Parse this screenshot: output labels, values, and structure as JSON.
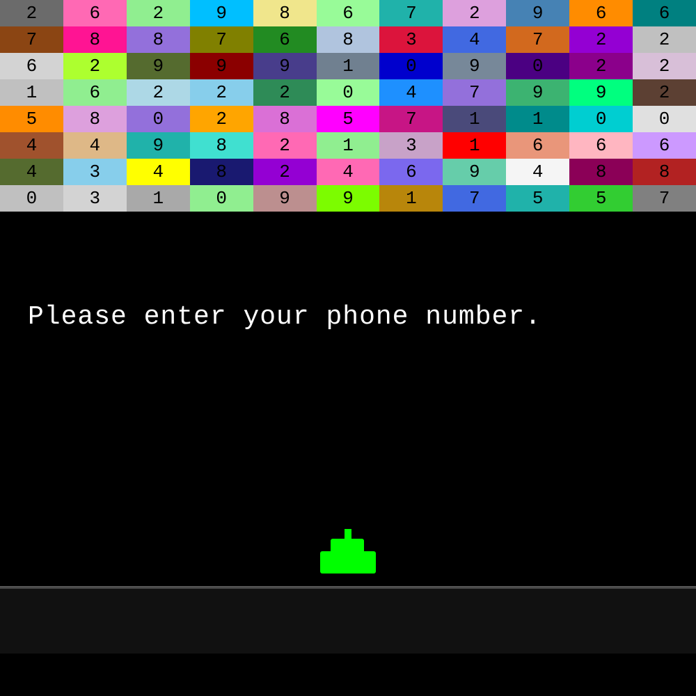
{
  "grid": {
    "rows": [
      [
        {
          "value": "2",
          "bg": "#6b6b6b"
        },
        {
          "value": "6",
          "bg": "#ff69b4"
        },
        {
          "value": "2",
          "bg": "#90ee90"
        },
        {
          "value": "9",
          "bg": "#00bfff"
        },
        {
          "value": "8",
          "bg": "#f0e68c"
        },
        {
          "value": "6",
          "bg": "#98fb98"
        },
        {
          "value": "7",
          "bg": "#20b2aa"
        },
        {
          "value": "2",
          "bg": "#dda0dd"
        },
        {
          "value": "9",
          "bg": "#4682b4"
        },
        {
          "value": "6",
          "bg": "#ff8c00"
        },
        {
          "value": "6",
          "bg": "#008080"
        }
      ],
      [
        {
          "value": "7",
          "bg": "#8b4513"
        },
        {
          "value": "8",
          "bg": "#ff1493"
        },
        {
          "value": "8",
          "bg": "#9370db"
        },
        {
          "value": "7",
          "bg": "#808000"
        },
        {
          "value": "6",
          "bg": "#228b22"
        },
        {
          "value": "8",
          "bg": "#b0c4de"
        },
        {
          "value": "3",
          "bg": "#dc143c"
        },
        {
          "value": "4",
          "bg": "#4169e1"
        },
        {
          "value": "7",
          "bg": "#d2691e"
        },
        {
          "value": "2",
          "bg": "#9400d3"
        },
        {
          "value": "2",
          "bg": "#c0c0c0"
        }
      ],
      [
        {
          "value": "6",
          "bg": "#d3d3d3"
        },
        {
          "value": "2",
          "bg": "#adff2f"
        },
        {
          "value": "9",
          "bg": "#556b2f"
        },
        {
          "value": "9",
          "bg": "#8b0000"
        },
        {
          "value": "9",
          "bg": "#483d8b"
        },
        {
          "value": "1",
          "bg": "#708090"
        },
        {
          "value": "0",
          "bg": "#0000cd"
        },
        {
          "value": "9",
          "bg": "#778899"
        },
        {
          "value": "0",
          "bg": "#4b0082"
        },
        {
          "value": "2",
          "bg": "#8b008b"
        },
        {
          "value": "2",
          "bg": "#d8bfd8"
        }
      ],
      [
        {
          "value": "1",
          "bg": "#c0c0c0"
        },
        {
          "value": "6",
          "bg": "#90ee90"
        },
        {
          "value": "2",
          "bg": "#add8e6"
        },
        {
          "value": "2",
          "bg": "#87ceeb"
        },
        {
          "value": "2",
          "bg": "#2e8b57"
        },
        {
          "value": "0",
          "bg": "#98fb98"
        },
        {
          "value": "4",
          "bg": "#1e90ff"
        },
        {
          "value": "7",
          "bg": "#9370db"
        },
        {
          "value": "9",
          "bg": "#3cb371"
        },
        {
          "value": "9",
          "bg": "#00ff7f"
        },
        {
          "value": "2",
          "bg": "#5c4033"
        }
      ],
      [
        {
          "value": "5",
          "bg": "#ff8c00"
        },
        {
          "value": "8",
          "bg": "#dda0dd"
        },
        {
          "value": "0",
          "bg": "#9370db"
        },
        {
          "value": "2",
          "bg": "#ffa500"
        },
        {
          "value": "8",
          "bg": "#da70d6"
        },
        {
          "value": "5",
          "bg": "#ff00ff"
        },
        {
          "value": "7",
          "bg": "#c71585"
        },
        {
          "value": "1",
          "bg": "#4a4a7a"
        },
        {
          "value": "1",
          "bg": "#008b8b"
        },
        {
          "value": "0",
          "bg": "#00ced1"
        },
        {
          "value": "0",
          "bg": "#e0e0e0"
        }
      ],
      [
        {
          "value": "4",
          "bg": "#a0522d"
        },
        {
          "value": "4",
          "bg": "#deb887"
        },
        {
          "value": "9",
          "bg": "#20b2aa"
        },
        {
          "value": "8",
          "bg": "#40e0d0"
        },
        {
          "value": "2",
          "bg": "#ff69b4"
        },
        {
          "value": "1",
          "bg": "#90ee90"
        },
        {
          "value": "3",
          "bg": "#c8a2c8"
        },
        {
          "value": "1",
          "bg": "#ff0000"
        },
        {
          "value": "6",
          "bg": "#e9967a"
        },
        {
          "value": "6",
          "bg": "#ffb6c1"
        },
        {
          "value": "6",
          "bg": "#cc99ff"
        }
      ],
      [
        {
          "value": "4",
          "bg": "#556b2f"
        },
        {
          "value": "3",
          "bg": "#87ceeb"
        },
        {
          "value": "4",
          "bg": "#ffff00"
        },
        {
          "value": "8",
          "bg": "#191970"
        },
        {
          "value": "2",
          "bg": "#9400d3"
        },
        {
          "value": "4",
          "bg": "#ff69b4"
        },
        {
          "value": "6",
          "bg": "#7b68ee"
        },
        {
          "value": "9",
          "bg": "#66cdaa"
        },
        {
          "value": "4",
          "bg": "#f5f5f5"
        },
        {
          "value": "8",
          "bg": "#8b0057"
        },
        {
          "value": "8",
          "bg": "#b22222"
        }
      ],
      [
        {
          "value": "0",
          "bg": "#c0c0c0"
        },
        {
          "value": "3",
          "bg": "#d3d3d3"
        },
        {
          "value": "1",
          "bg": "#a9a9a9"
        },
        {
          "value": "0",
          "bg": "#90ee90"
        },
        {
          "value": "9",
          "bg": "#bc8f8f"
        },
        {
          "value": "9",
          "bg": "#7cfc00"
        },
        {
          "value": "1",
          "bg": "#b8860b"
        },
        {
          "value": "7",
          "bg": "#4169e1"
        },
        {
          "value": "5",
          "bg": "#20b2aa"
        },
        {
          "value": "5",
          "bg": "#32cd32"
        },
        {
          "value": "7",
          "bg": "#808080"
        }
      ]
    ]
  },
  "prompt": {
    "text": "Please enter your phone number."
  },
  "input": {
    "placeholder": "",
    "value": ""
  },
  "colors": {
    "background": "#000000",
    "tank": "#00ff00",
    "text": "#ffffff"
  }
}
